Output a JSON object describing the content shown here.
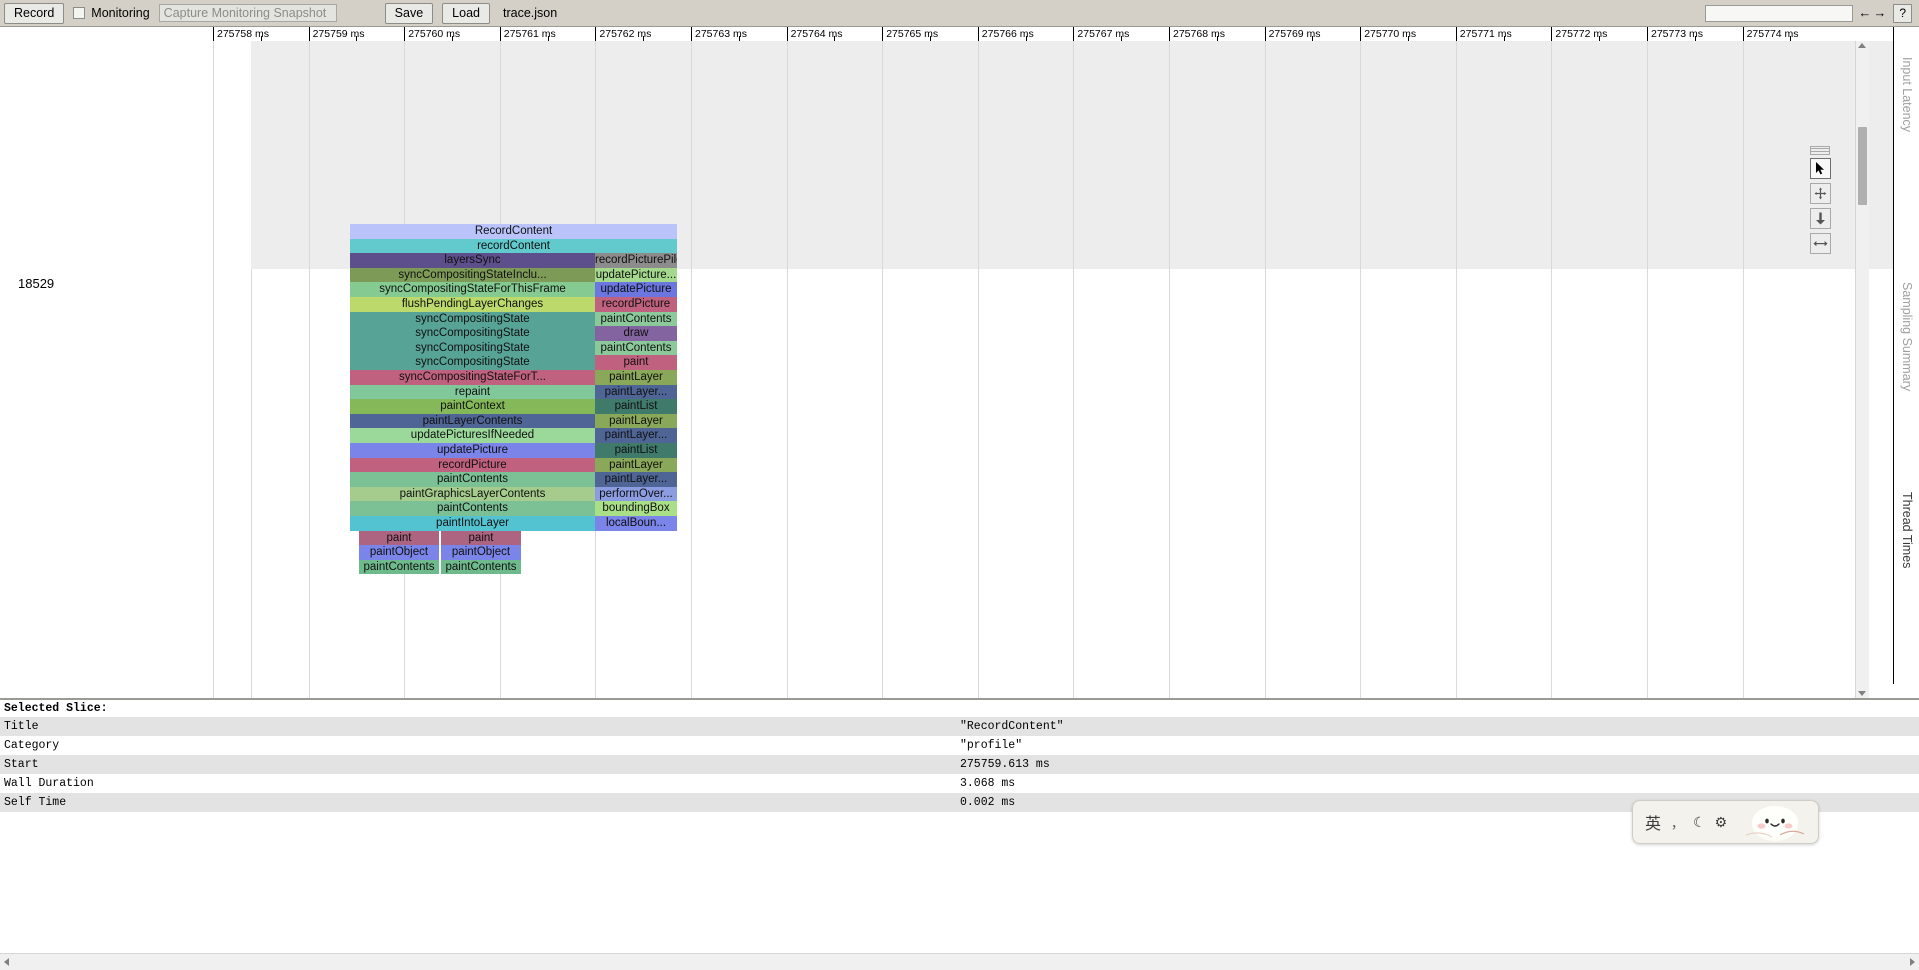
{
  "toolbar": {
    "record_label": "Record",
    "monitoring_label": "Monitoring",
    "capture_placeholder": "Capture Monitoring Snapshot",
    "capture_value": "",
    "save_label": "Save",
    "load_label": "Load",
    "filename": "trace.json",
    "search_value": "",
    "search_placeholder": "",
    "prev_arrow": "←",
    "next_arrow": "→",
    "help_label": "?"
  },
  "ruler": {
    "unit": "ms",
    "ticks": [
      "275758 ms",
      "275759 ms",
      "275760 ms",
      "275761 ms",
      "275762 ms",
      "275763 ms",
      "275764 ms",
      "275765 ms",
      "275766 ms",
      "275767 ms",
      "275768 ms",
      "275769 ms",
      "275770 ms",
      "275771 ms",
      "275772 ms",
      "275773 ms",
      "275774 ms"
    ]
  },
  "track": {
    "thread_label": "18529"
  },
  "nav_controls": {
    "select_tool": "selection-arrow",
    "pan_tool": "pan-cross",
    "zoom_tool": "zoom-down-arrow",
    "marker_tool": "timing-marker"
  },
  "right_tabs": [
    {
      "label": "Input Latency",
      "state": "dim"
    },
    {
      "label": "Sampling Summary",
      "state": "dim"
    },
    {
      "label": "Thread Times",
      "state": "active"
    }
  ],
  "flame_chart": {
    "left_column": [
      {
        "label": "RecordContent",
        "color": "#bac4fb"
      },
      {
        "label": "recordContent",
        "color": "#62c9cc"
      },
      {
        "label": "layersSync",
        "color": "#5c4f8c"
      },
      {
        "label": "syncCompositingStateInclu...",
        "color": "#7d9a56"
      },
      {
        "label": "syncCompositingStateForThisFrame",
        "color": "#84ca91"
      },
      {
        "label": "flushPendingLayerChanges",
        "color": "#bcda6b"
      },
      {
        "label": "syncCompositingState",
        "color": "#57a396"
      },
      {
        "label": "syncCompositingState",
        "color": "#57a396"
      },
      {
        "label": "syncCompositingState",
        "color": "#57a396"
      },
      {
        "label": "syncCompositingState",
        "color": "#57a396"
      },
      {
        "label": "syncCompositingStateForT...",
        "color": "#c0617f"
      },
      {
        "label": "repaint",
        "color": "#80c79a"
      },
      {
        "label": "paintContext",
        "color": "#84b858"
      },
      {
        "label": "paintLayerContents",
        "color": "#4e6596"
      },
      {
        "label": "updatePicturesIfNeeded",
        "color": "#9bd99b"
      },
      {
        "label": "updatePicture",
        "color": "#7b84e8"
      },
      {
        "label": "recordPicture",
        "color": "#c0617f"
      },
      {
        "label": "paintContents",
        "color": "#7cc195"
      },
      {
        "label": "paintGraphicsLayerContents",
        "color": "#a5cc8c"
      },
      {
        "label": "paintContents",
        "color": "#7cc195"
      },
      {
        "label": "paintIntoLayer",
        "color": "#53c3d1"
      }
    ],
    "right_column": [
      {
        "label": "recordPicturePile",
        "color": "#8c8c8c"
      },
      {
        "label": "updatePicture...",
        "color": "#a4d98d"
      },
      {
        "label": "updatePicture",
        "color": "#6b76e0"
      },
      {
        "label": "recordPicture",
        "color": "#c0617f"
      },
      {
        "label": "paintContents",
        "color": "#8cc99a"
      },
      {
        "label": "draw",
        "color": "#8364a0"
      },
      {
        "label": "paintContents",
        "color": "#8cc99a"
      },
      {
        "label": "paint",
        "color": "#c0617f"
      },
      {
        "label": "paintLayer",
        "color": "#8aa859"
      },
      {
        "label": "paintLayer...",
        "color": "#4e6596"
      },
      {
        "label": "paintList",
        "color": "#3f7a6b"
      },
      {
        "label": "paintLayer",
        "color": "#8aa859"
      },
      {
        "label": "paintLayer...",
        "color": "#4e6596"
      },
      {
        "label": "paintList",
        "color": "#3f7a6b"
      },
      {
        "label": "paintLayer",
        "color": "#8aa859"
      },
      {
        "label": "paintLayer...",
        "color": "#4e6596"
      },
      {
        "label": "performOver...",
        "color": "#8b9ce0"
      },
      {
        "label": "boundingBox",
        "color": "#a9df87"
      },
      {
        "label": "localBoun...",
        "color": "#7b84e8"
      }
    ],
    "bottom_rows": [
      {
        "slices": [
          {
            "label": "paint",
            "color": "#ad6480"
          },
          {
            "label": "paint",
            "color": "#ad6480"
          }
        ]
      },
      {
        "slices": [
          {
            "label": "paintObject",
            "color": "#7b84e8"
          },
          {
            "label": "paintObject",
            "color": "#7b84e8"
          }
        ]
      },
      {
        "slices": [
          {
            "label": "paintContents",
            "color": "#6fba8d"
          },
          {
            "label": "paintContents",
            "color": "#6fba8d"
          }
        ]
      }
    ]
  },
  "details": {
    "title": "Selected Slice:",
    "rows": [
      {
        "key": "Title",
        "value": "\"RecordContent\""
      },
      {
        "key": "Category",
        "value": "\"profile\""
      },
      {
        "key": "Start",
        "value": "275759.613 ms"
      },
      {
        "key": "Wall Duration",
        "value": "3.068 ms"
      },
      {
        "key": "Self Time",
        "value": "0.002 ms"
      }
    ]
  },
  "ime": {
    "language": "英",
    "punctuation": "，",
    "moon": "☾",
    "gear": "⚙"
  }
}
